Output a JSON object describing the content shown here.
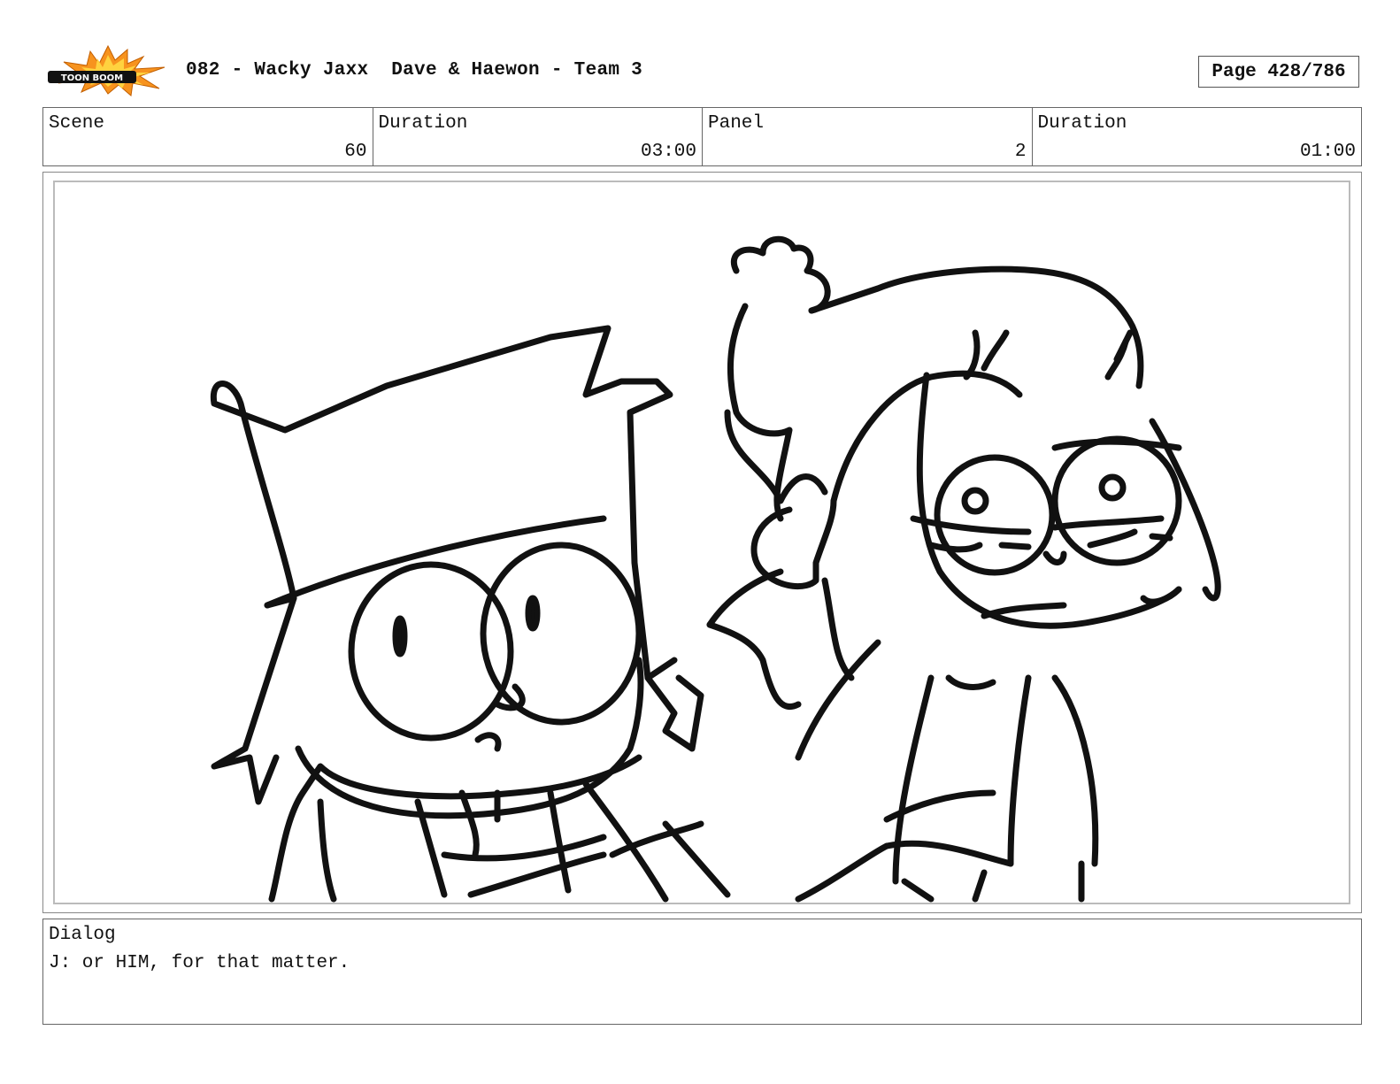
{
  "header": {
    "logo_text": "TOON BOOM",
    "title": "082 - Wacky Jaxx  Dave & Haewon - Team 3",
    "page": "Page 428/786"
  },
  "info": {
    "scene_label": "Scene",
    "scene_value": "60",
    "scene_duration_label": "Duration",
    "scene_duration_value": "03:00",
    "panel_label": "Panel",
    "panel_value": "2",
    "panel_duration_label": "Duration",
    "panel_duration_value": "01:00"
  },
  "dialog": {
    "label": "Dialog",
    "text": "J: or HIM, for that matter."
  },
  "colors": {
    "logo_burst_orange": "#f7931e",
    "logo_burst_yellow": "#ffd23f",
    "ink": "#111111"
  }
}
